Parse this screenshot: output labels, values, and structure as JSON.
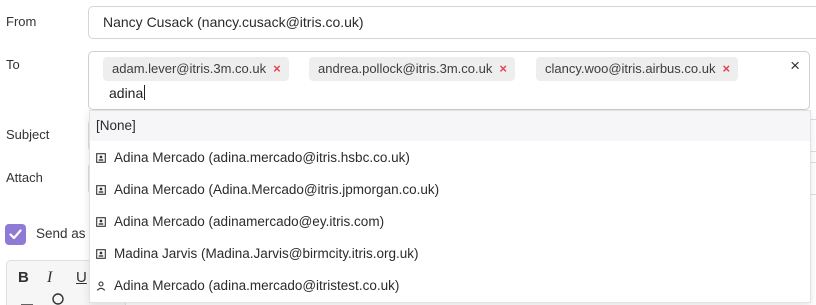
{
  "labels": {
    "from": "From",
    "to": "To",
    "subject": "Subject",
    "attach": "Attach"
  },
  "from_value": "Nancy Cusack (nancy.cusack@itris.co.uk)",
  "to": {
    "recipients": [
      "adam.lever@itris.3m.co.uk",
      "andrea.pollock@itris.3m.co.uk",
      "clancy.woo@itris.airbus.co.uk"
    ],
    "remove_glyph": "×",
    "clear_glyph": "×",
    "input_value": "adina"
  },
  "autocomplete": {
    "none_option": "[None]",
    "options": [
      {
        "label": "Adina Mercado (adina.mercado@itris.hsbc.co.uk)",
        "icon": "contact-card-icon"
      },
      {
        "label": "Adina Mercado (Adina.Mercado@itris.jpmorgan.co.uk)",
        "icon": "contact-card-icon"
      },
      {
        "label": "Adina Mercado (adinamercado@ey.itris.com)",
        "icon": "contact-card-icon"
      },
      {
        "label": "Madina Jarvis (Madina.Jarvis@birmcity.itris.org.uk)",
        "icon": "contact-card-icon"
      },
      {
        "label": "Adina Mercado (adina.mercado@itristest.co.uk)",
        "icon": "person-icon"
      }
    ]
  },
  "send_as_label": "Send as",
  "send_as_checked": true,
  "toolbar": {
    "bold": "B",
    "italic": "I",
    "underline": "U"
  },
  "colors": {
    "checkbox": "#8f7bd6",
    "remove": "#e0474c",
    "chip": "#eeeeef"
  }
}
